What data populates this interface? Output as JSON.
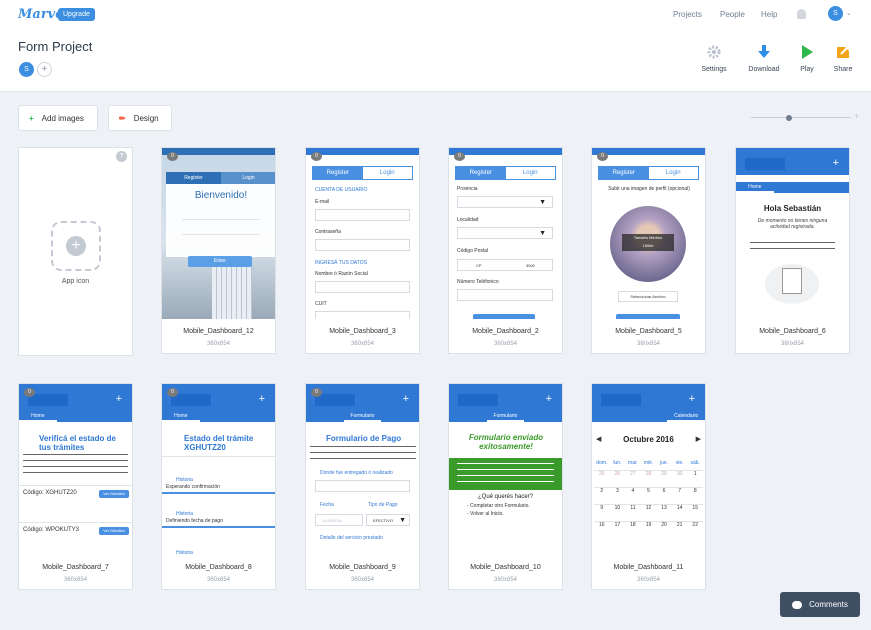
{
  "brand": {
    "logo": "Marvel",
    "upgrade": "Upgrade"
  },
  "nav": {
    "projects": "Projects",
    "people": "People",
    "help": "Help",
    "user_initial": "S"
  },
  "project": {
    "title": "Form Project",
    "member_initial": "S"
  },
  "toolbar": {
    "settings": "Settings",
    "download": "Download",
    "play": "Play",
    "share": "Share"
  },
  "actions": {
    "add_images": "Add images",
    "design": "Design"
  },
  "app_icon_label": "App icon",
  "screens": [
    {
      "name": "Mobile_Dashboard_12",
      "size": "360x854"
    },
    {
      "name": "Mobile_Dashboard_3",
      "size": "360x854"
    },
    {
      "name": "Mobile_Dashboard_2",
      "size": "360x854"
    },
    {
      "name": "Mobile_Dashboard_5",
      "size": "360x854"
    },
    {
      "name": "Mobile_Dashboard_6",
      "size": "360x854"
    },
    {
      "name": "Mobile_Dashboard_7",
      "size": "360x854"
    },
    {
      "name": "Mobile_Dashboard_8",
      "size": "360x854"
    },
    {
      "name": "Mobile_Dashboard_9",
      "size": "360x854"
    },
    {
      "name": "Mobile_Dashboard_10",
      "size": "360x854"
    },
    {
      "name": "Mobile_Dashboard_11",
      "size": "360x854"
    }
  ],
  "thumbs": {
    "badge": "0",
    "register": "Register",
    "login": "Login",
    "bienvenido": "Bienvenido!",
    "enter": "Enter",
    "home": "Home",
    "formulario": "Formulario",
    "calendario": "Calendario",
    "cuenta": "CUENTA DE USUARIO",
    "email": "E-mail",
    "contrasena": "Contraseña",
    "ingresa": "INGRESÁ TUS DATOS",
    "nombre": "Nombre ó Razón Social",
    "cuit": "CUIT",
    "provincia": "Provincia",
    "localidad": "Localidad",
    "codigo_postal": "Código Postal",
    "telefono": "Número Teléfonico",
    "cp": "CP",
    "cp_value": "3500",
    "subir": "Subir una imagen de perfil (opcional)",
    "tamano": "Tamaño Mínimo",
    "tamano_value": "150kb",
    "seleccionar": "Seleccionar Archivo",
    "hola": "Hola Sebastián",
    "hola_sub": "De momento no tienes ninguna actividad registrada.",
    "verifica": "Verificá el estado de tus trámites",
    "codigo1": "Código: XGHUTZ20",
    "codigo2": "Código: WPOKUTY3",
    "ver": "Ver Detalles",
    "estado_tramite": "Estado del trámite XGHUTZ20",
    "historia": "Historia",
    "esperando": "Esperando confirmación",
    "definiendo": "Definiendo fecha de pago",
    "form_pago": "Formulario de Pago",
    "donde": "Donde fue entregado ó realizado",
    "fecha": "Fecha",
    "tipo_pago": "Tipo de Pago",
    "efectivo": "EFECTIVO",
    "fecha_val": "10/10/2016",
    "detalle": "Detalle del servicio prestado",
    "enviado": "Formulario enviado exitosamente!",
    "que_hacer": "¿Qué querés hacer?",
    "completar": "- Completar otro Formulario.",
    "volver": "- Volver al Inicio.",
    "mes": "Octubre 2016",
    "dias": [
      "dom.",
      "lun.",
      "mar.",
      "mié.",
      "jue.",
      "vie.",
      "sáb."
    ],
    "semanas": [
      [
        "25",
        "26",
        "27",
        "28",
        "29",
        "30",
        "1"
      ],
      [
        "2",
        "3",
        "4",
        "5",
        "6",
        "7",
        "8"
      ],
      [
        "9",
        "10",
        "11",
        "12",
        "13",
        "14",
        "15"
      ],
      [
        "16",
        "17",
        "18",
        "19",
        "20",
        "21",
        "22"
      ]
    ]
  },
  "comments": "Comments"
}
